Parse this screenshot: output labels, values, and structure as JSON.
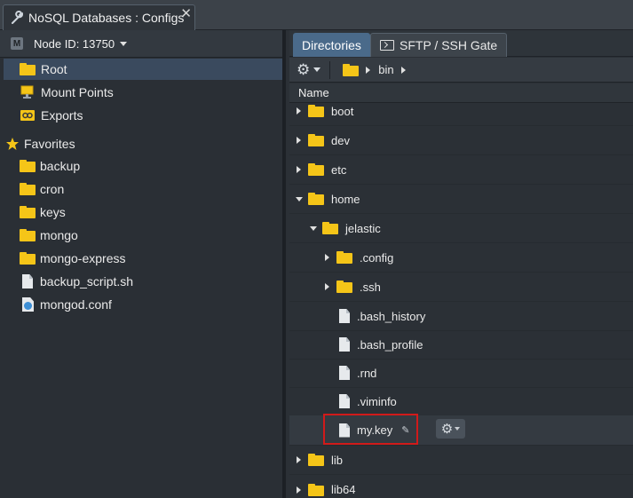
{
  "window": {
    "title": "NoSQL Databases : Configs"
  },
  "node": {
    "badge": "M",
    "label": "Node ID: 13750"
  },
  "left_tree": {
    "roots": [
      {
        "label": "Root",
        "icon": "folder-icon",
        "selected": true
      },
      {
        "label": "Mount Points",
        "icon": "monitor-icon"
      },
      {
        "label": "Exports",
        "icon": "link-icon"
      }
    ],
    "favorites_label": "Favorites",
    "favorites": [
      {
        "label": "backup",
        "icon": "folder-icon"
      },
      {
        "label": "cron",
        "icon": "folder-icon"
      },
      {
        "label": "keys",
        "icon": "folder-icon"
      },
      {
        "label": "mongo",
        "icon": "folder-icon"
      },
      {
        "label": "mongo-express",
        "icon": "folder-icon"
      },
      {
        "label": "backup_script.sh",
        "icon": "file-icon"
      },
      {
        "label": "mongod.conf",
        "icon": "config-file-icon"
      }
    ]
  },
  "right": {
    "tabs": [
      {
        "label": "Directories",
        "active": true
      },
      {
        "label": "SFTP / SSH Gate",
        "active": false
      }
    ],
    "breadcrumb": "bin",
    "column_header": "Name",
    "rows": [
      {
        "label": "boot",
        "type": "folder",
        "expander": "collapsed"
      },
      {
        "label": "dev",
        "type": "folder",
        "expander": "collapsed"
      },
      {
        "label": "etc",
        "type": "folder",
        "expander": "collapsed"
      },
      {
        "label": "home",
        "type": "folder",
        "expander": "expanded"
      },
      {
        "label": "jelastic",
        "type": "folder",
        "expander": "expanded"
      },
      {
        "label": ".config",
        "type": "folder",
        "expander": "collapsed"
      },
      {
        "label": ".ssh",
        "type": "folder",
        "expander": "collapsed"
      },
      {
        "label": ".bash_history",
        "type": "file"
      },
      {
        "label": ".bash_profile",
        "type": "file"
      },
      {
        "label": ".rnd",
        "type": "file"
      },
      {
        "label": ".viminfo",
        "type": "file"
      },
      {
        "label": "my.key",
        "type": "file",
        "highlighted": true
      },
      {
        "label": "lib",
        "type": "folder",
        "expander": "collapsed"
      },
      {
        "label": "lib64",
        "type": "folder",
        "expander": "collapsed"
      }
    ]
  },
  "colors": {
    "accent_tab": "#4a6a8a",
    "folder": "#f5c518",
    "highlight_box": "#d11a1a",
    "favorites_star": "#f5c518"
  }
}
